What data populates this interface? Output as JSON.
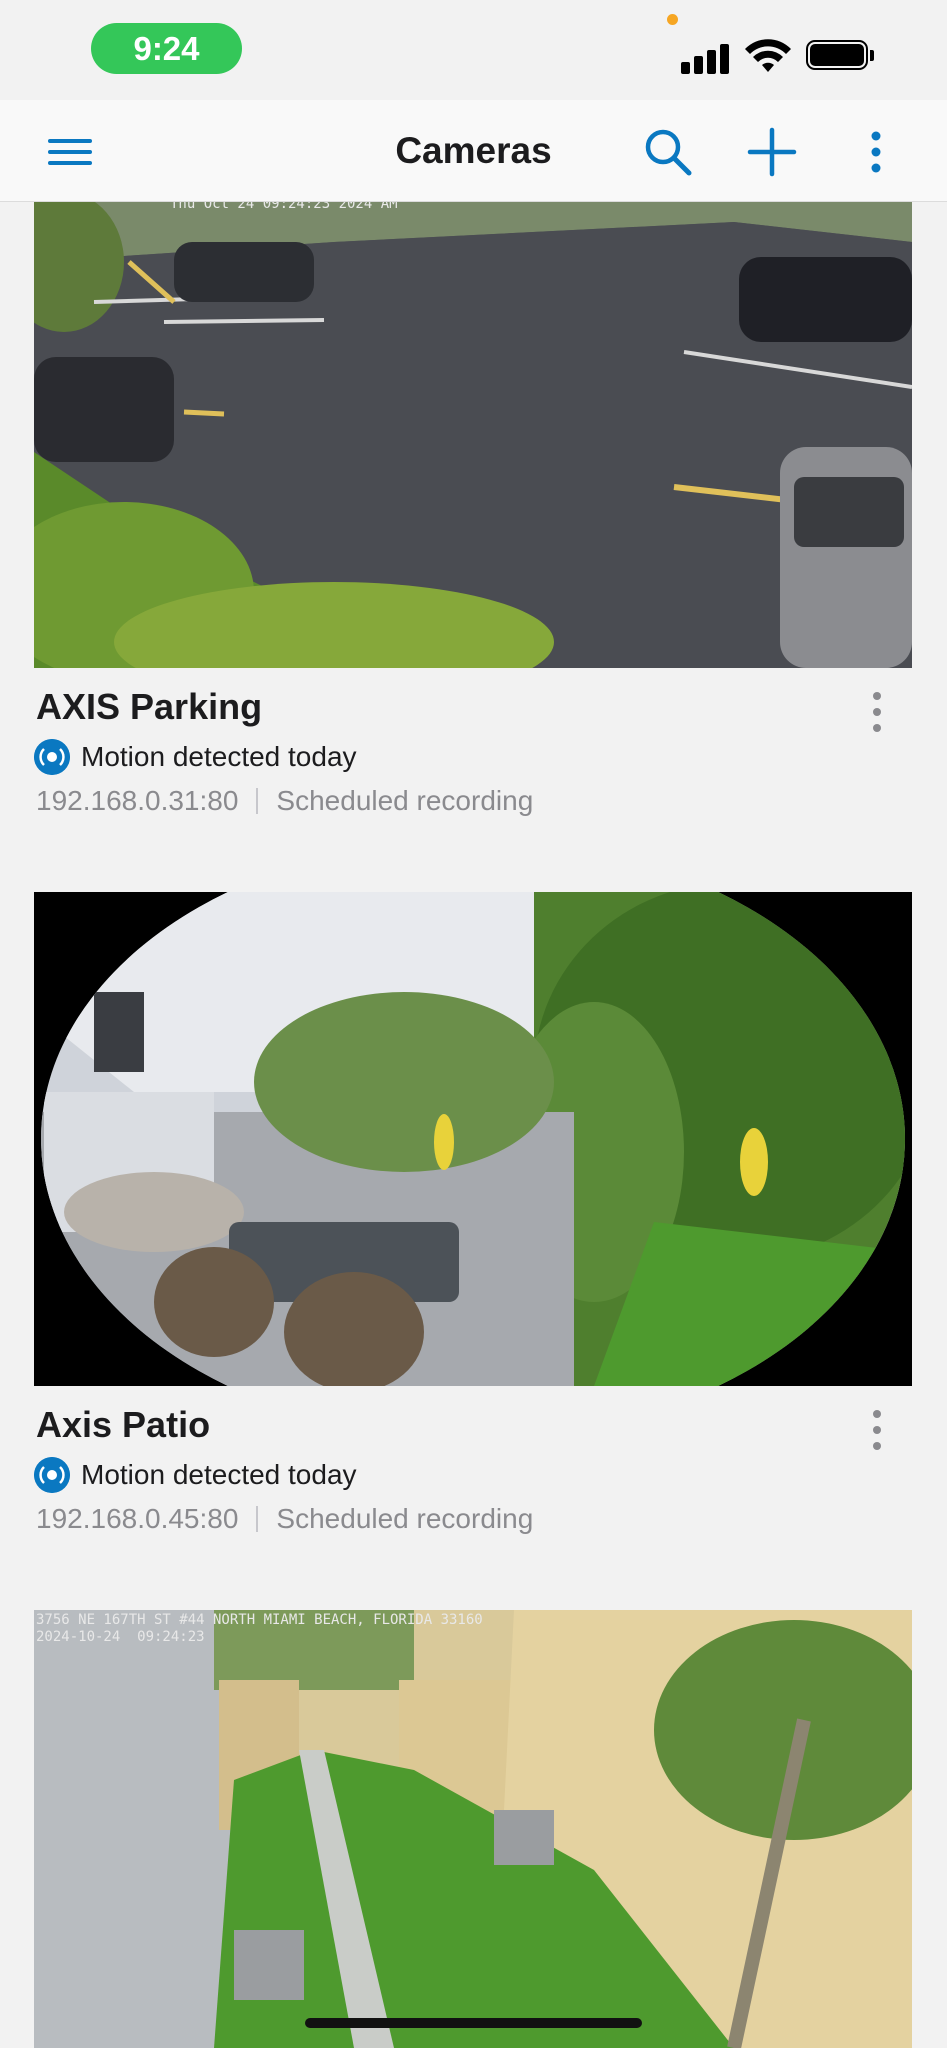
{
  "status_bar": {
    "time": "9:24"
  },
  "nav": {
    "title": "Cameras"
  },
  "cameras": [
    {
      "name": "AXIS Parking",
      "motion": "Motion detected today",
      "address": "192.168.0.31:80",
      "recording": "Scheduled recording",
      "osd": "Thu Oct 24 09:24:23 2024 AM"
    },
    {
      "name": "Axis Patio",
      "motion": "Motion detected today",
      "address": "192.168.0.45:80",
      "recording": "Scheduled recording"
    },
    {
      "name": "",
      "osd": "3756 NE 167TH ST #44 NORTH MIAMI BEACH, FLORIDA 33160\n2024-10-24  09:24:23"
    }
  ],
  "colors": {
    "accent": "#0a78c1",
    "status_green": "#34c759",
    "background": "#f2f2f2"
  }
}
